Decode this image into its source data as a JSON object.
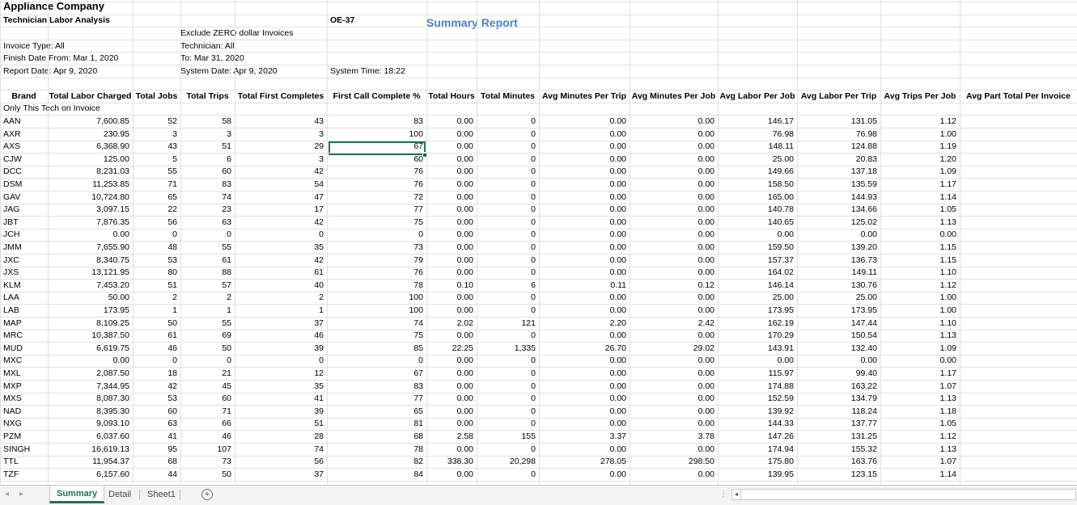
{
  "report": {
    "company": "Appliance Company",
    "title": "Technician Labor Analysis",
    "code": "OE-37",
    "summary_label": "Summary Report",
    "exclude": "Exclude ZERO dollar Invoices",
    "technician": "Technician: All",
    "invoice_type": "Invoice Type: All",
    "finish_from": "Finish Date From: Mar 1, 2020",
    "to": "To: Mar 31, 2020",
    "report_date": "Report Date: Apr 9, 2020",
    "system_date": "System Date: Apr 9, 2020",
    "system_time": "System Time: 18:22",
    "section_label": "Only This Tech on Invoice"
  },
  "columns": [
    "Brand",
    "Total Labor Charged",
    "Total Jobs",
    "Total Trips",
    "Total First Completes",
    "First Call Complete %",
    "Total Hours",
    "Total Minutes",
    "Avg Minutes Per Trip",
    "Avg Minutes Per Job",
    "Avg Labor Per Job",
    "Avg Labor Per Trip",
    "Avg Trips Per Job",
    "Avg Part Total Per Invoice"
  ],
  "rows": [
    [
      "AAN",
      "7,600.85",
      "52",
      "58",
      "43",
      "83",
      "0.00",
      "0",
      "0.00",
      "0.00",
      "146.17",
      "131.05",
      "1.12"
    ],
    [
      "AXR",
      "230.95",
      "3",
      "3",
      "3",
      "100",
      "0.00",
      "0",
      "0.00",
      "0.00",
      "76.98",
      "76.98",
      "1.00"
    ],
    [
      "AXS",
      "6,368.90",
      "43",
      "51",
      "29",
      "67",
      "0.00",
      "0",
      "0.00",
      "0.00",
      "148.11",
      "124.88",
      "1.19"
    ],
    [
      "CJW",
      "125.00",
      "5",
      "6",
      "3",
      "60",
      "0.00",
      "0",
      "0.00",
      "0.00",
      "25.00",
      "20.83",
      "1.20"
    ],
    [
      "DCC",
      "8,231.03",
      "55",
      "60",
      "42",
      "76",
      "0.00",
      "0",
      "0.00",
      "0.00",
      "149.66",
      "137.18",
      "1.09"
    ],
    [
      "DSM",
      "11,253.85",
      "71",
      "83",
      "54",
      "76",
      "0.00",
      "0",
      "0.00",
      "0.00",
      "158.50",
      "135.59",
      "1.17"
    ],
    [
      "GAV",
      "10,724.80",
      "65",
      "74",
      "47",
      "72",
      "0.00",
      "0",
      "0.00",
      "0.00",
      "165.00",
      "144.93",
      "1.14"
    ],
    [
      "JAG",
      "3,097.15",
      "22",
      "23",
      "17",
      "77",
      "0.00",
      "0",
      "0.00",
      "0.00",
      "140.78",
      "134.66",
      "1.05"
    ],
    [
      "JBT",
      "7,876.35",
      "56",
      "63",
      "42",
      "75",
      "0.00",
      "0",
      "0.00",
      "0.00",
      "140.65",
      "125.02",
      "1.13"
    ],
    [
      "JCH",
      "0.00",
      "0",
      "0",
      "0",
      "0",
      "0.00",
      "0",
      "0.00",
      "0.00",
      "0.00",
      "0.00",
      "0.00"
    ],
    [
      "JMM",
      "7,655.90",
      "48",
      "55",
      "35",
      "73",
      "0.00",
      "0",
      "0.00",
      "0.00",
      "159.50",
      "139.20",
      "1.15"
    ],
    [
      "JXC",
      "8,340.75",
      "53",
      "61",
      "42",
      "79",
      "0.00",
      "0",
      "0.00",
      "0.00",
      "157.37",
      "136.73",
      "1.15"
    ],
    [
      "JXS",
      "13,121.95",
      "80",
      "88",
      "61",
      "76",
      "0.00",
      "0",
      "0.00",
      "0.00",
      "164.02",
      "149.11",
      "1.10"
    ],
    [
      "KLM",
      "7,453.20",
      "51",
      "57",
      "40",
      "78",
      "0.10",
      "6",
      "0.11",
      "0.12",
      "146.14",
      "130.76",
      "1.12"
    ],
    [
      "LAA",
      "50.00",
      "2",
      "2",
      "2",
      "100",
      "0.00",
      "0",
      "0.00",
      "0.00",
      "25.00",
      "25.00",
      "1.00"
    ],
    [
      "LAB",
      "173.95",
      "1",
      "1",
      "1",
      "100",
      "0.00",
      "0",
      "0.00",
      "0.00",
      "173.95",
      "173.95",
      "1.00"
    ],
    [
      "MAP",
      "8,109.25",
      "50",
      "55",
      "37",
      "74",
      "2.02",
      "121",
      "2.20",
      "2.42",
      "162.19",
      "147.44",
      "1.10"
    ],
    [
      "MRC",
      "10,387.50",
      "61",
      "69",
      "46",
      "75",
      "0.00",
      "0",
      "0.00",
      "0.00",
      "170.29",
      "150.54",
      "1.13"
    ],
    [
      "MUD",
      "6,619.75",
      "46",
      "50",
      "39",
      "85",
      "22.25",
      "1,335",
      "26.70",
      "29.02",
      "143.91",
      "132.40",
      "1.09"
    ],
    [
      "MXC",
      "0.00",
      "0",
      "0",
      "0",
      "0",
      "0.00",
      "0",
      "0.00",
      "0.00",
      "0.00",
      "0.00",
      "0.00"
    ],
    [
      "MXL",
      "2,087.50",
      "18",
      "21",
      "12",
      "67",
      "0.00",
      "0",
      "0.00",
      "0.00",
      "115.97",
      "99.40",
      "1.17"
    ],
    [
      "MXP",
      "7,344.95",
      "42",
      "45",
      "35",
      "83",
      "0.00",
      "0",
      "0.00",
      "0.00",
      "174.88",
      "163.22",
      "1.07"
    ],
    [
      "MXS",
      "8,087.30",
      "53",
      "60",
      "41",
      "77",
      "0.00",
      "0",
      "0.00",
      "0.00",
      "152.59",
      "134.79",
      "1.13"
    ],
    [
      "NAD",
      "8,395.30",
      "60",
      "71",
      "39",
      "65",
      "0.00",
      "0",
      "0.00",
      "0.00",
      "139.92",
      "118.24",
      "1.18"
    ],
    [
      "NXG",
      "9,093.10",
      "63",
      "66",
      "51",
      "81",
      "0.00",
      "0",
      "0.00",
      "0.00",
      "144.33",
      "137.77",
      "1.05"
    ],
    [
      "PZM",
      "6,037.60",
      "41",
      "46",
      "28",
      "68",
      "2.58",
      "155",
      "3.37",
      "3.78",
      "147.26",
      "131.25",
      "1.12"
    ],
    [
      "SINGH",
      "16,619.13",
      "95",
      "107",
      "74",
      "78",
      "0.00",
      "0",
      "0.00",
      "0.00",
      "174.94",
      "155.32",
      "1.13"
    ],
    [
      "TTL",
      "11,954.37",
      "68",
      "73",
      "56",
      "82",
      "338.30",
      "20,298",
      "278.05",
      "298.50",
      "175.80",
      "163.76",
      "1.07"
    ],
    [
      "TZF",
      "6,157.60",
      "44",
      "50",
      "37",
      "84",
      "0.00",
      "0",
      "0.00",
      "0.00",
      "139.95",
      "123.15",
      "1.14"
    ]
  ],
  "tabs": [
    {
      "label": "Summary",
      "active": true
    },
    {
      "label": "Detail",
      "active": false
    },
    {
      "label": "Sheet1",
      "active": false
    }
  ],
  "icons": {
    "prev_sheet": "◂",
    "next_sheet": "▸",
    "add_sheet": "+",
    "more": "⋮",
    "scroll_left": "◂"
  },
  "colors": {
    "accent": "#217346",
    "report_title": "#4f81bd"
  }
}
